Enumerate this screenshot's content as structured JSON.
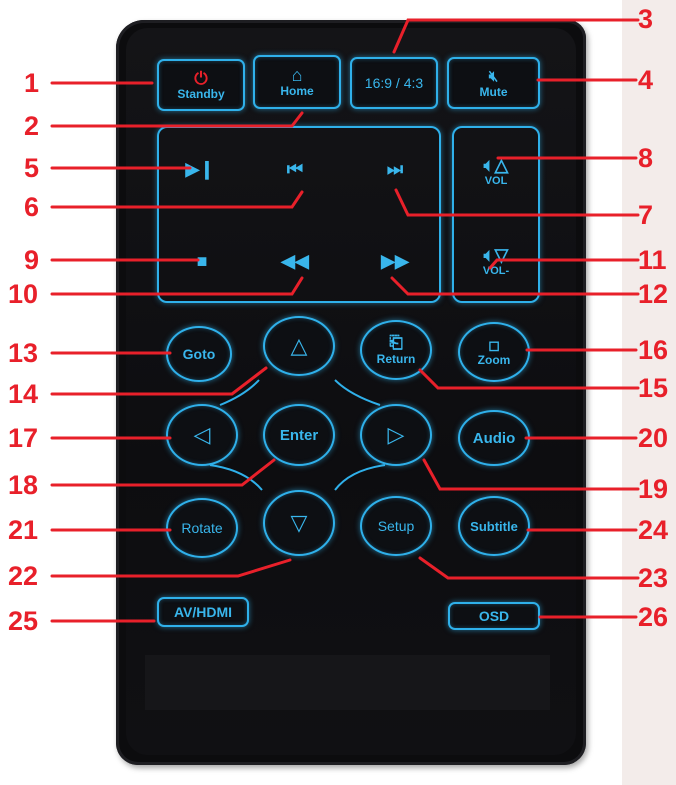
{
  "buttons": {
    "standby": "Standby",
    "home": "Home",
    "aspect": "16:9 / 4:3",
    "mute": "Mute",
    "vol_up": "VOL",
    "vol_down": "VOL-",
    "goto": "Goto",
    "return": "Return",
    "zoom": "Zoom",
    "enter": "Enter",
    "audio": "Audio",
    "rotate": "Rotate",
    "setup": "Setup",
    "subtitle": "Subtitle",
    "av_hdmi": "AV/HDMI",
    "osd": "OSD"
  },
  "callouts": [
    "1",
    "2",
    "3",
    "4",
    "5",
    "6",
    "7",
    "8",
    "9",
    "10",
    "11",
    "12",
    "13",
    "14",
    "15",
    "16",
    "17",
    "18",
    "19",
    "20",
    "21",
    "22",
    "23",
    "24",
    "25",
    "26"
  ],
  "colors": {
    "accent": "#2fb0ea",
    "callout": "#e8202a",
    "body": "#0c0c0e"
  }
}
